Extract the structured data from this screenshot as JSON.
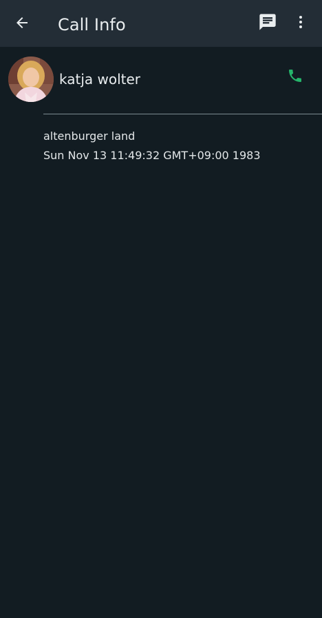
{
  "app_bar": {
    "title": "Call Info",
    "back_icon": "arrow-left-icon",
    "message_icon": "message-icon",
    "more_icon": "more-vertical-icon",
    "background_color": "#232d36"
  },
  "contact": {
    "name": "katja wolter",
    "avatar_icon": "contact-photo",
    "call_icon": "phone-icon",
    "call_icon_color": "#25b46a"
  },
  "call_entry": {
    "location": "altenburger land",
    "timestamp": "Sun Nov 13 11:49:32 GMT+09:00 1983"
  },
  "colors": {
    "background": "#121c22",
    "text": "#e9edef",
    "divider": "#7d8b92"
  }
}
